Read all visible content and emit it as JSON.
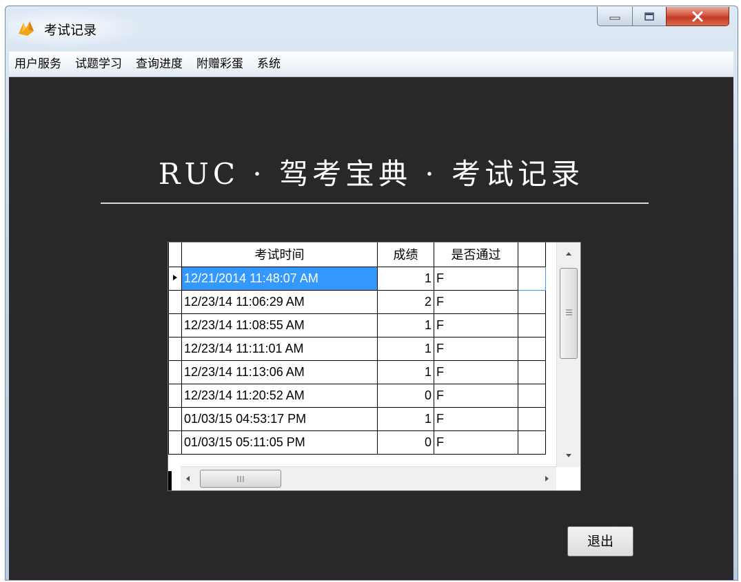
{
  "window": {
    "title": "考试记录",
    "icon": "app-logo-icon"
  },
  "menu": {
    "items": [
      {
        "label": "用户服务"
      },
      {
        "label": "试题学习"
      },
      {
        "label": "查询进度"
      },
      {
        "label": "附赠彩蛋"
      },
      {
        "label": "系统"
      }
    ]
  },
  "heading": "RUC · 驾考宝典 · 考试记录",
  "grid": {
    "columns": {
      "time": "考试时间",
      "score": "成绩",
      "passed": "是否通过"
    },
    "selected_row": 0,
    "rows": [
      {
        "time": "12/21/2014 11:48:07 AM",
        "score": "1",
        "passed": "F"
      },
      {
        "time": "12/23/14 11:06:29 AM",
        "score": "2",
        "passed": "F"
      },
      {
        "time": "12/23/14 11:08:55 AM",
        "score": "1",
        "passed": "F"
      },
      {
        "time": "12/23/14 11:11:01 AM",
        "score": "1",
        "passed": "F"
      },
      {
        "time": "12/23/14 11:13:06 AM",
        "score": "1",
        "passed": "F"
      },
      {
        "time": "12/23/14 11:20:52 AM",
        "score": "0",
        "passed": "F"
      },
      {
        "time": "01/03/15 04:53:17 PM",
        "score": "1",
        "passed": "F"
      },
      {
        "time": "01/03/15 05:11:05 PM",
        "score": "0",
        "passed": "F"
      }
    ]
  },
  "buttons": {
    "exit": "退出"
  },
  "colors": {
    "client_bg": "#29272a",
    "selection": "#3399ff",
    "heading_text": "#ffffff"
  }
}
